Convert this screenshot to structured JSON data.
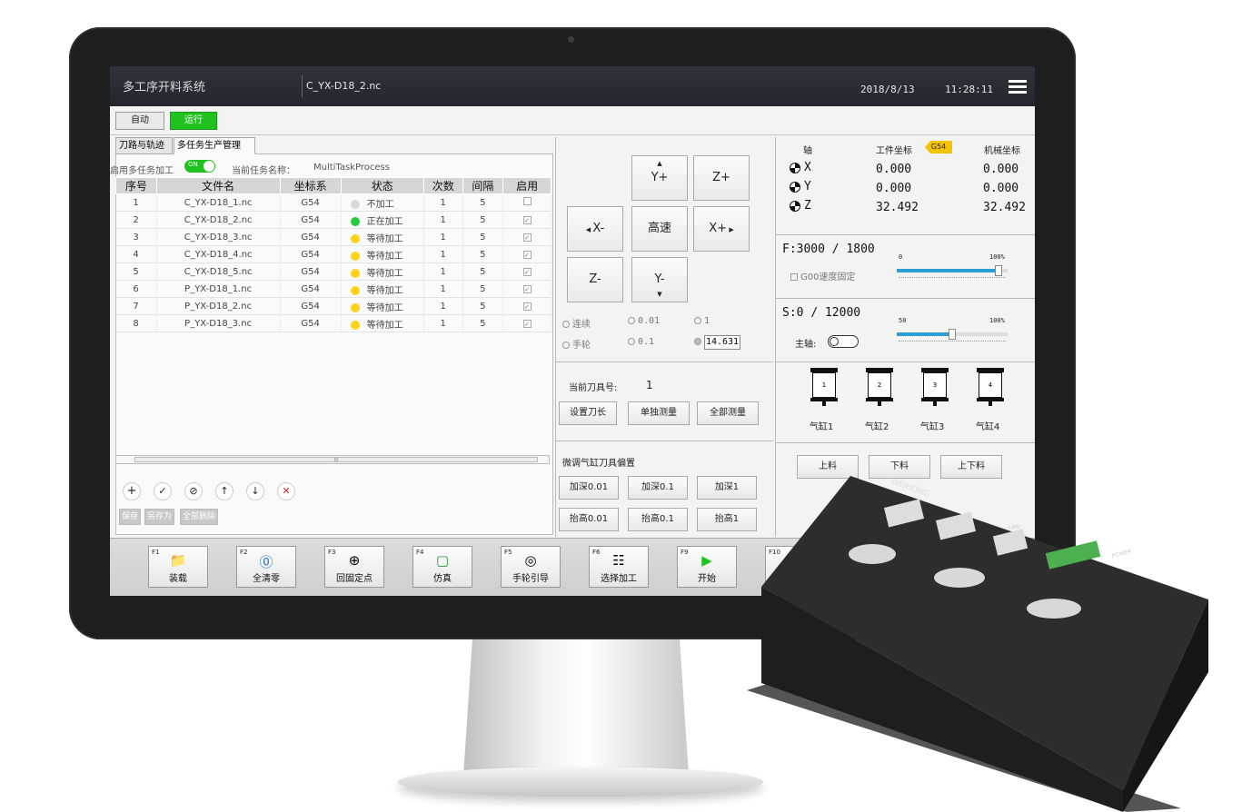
{
  "header": {
    "app_title": "多工序开料系统",
    "file_name": "C_YX-D18_2.nc",
    "date": "2018/8/13",
    "time": "11:28:11"
  },
  "mode": {
    "auto_label": "自动",
    "run_label": "运行"
  },
  "tabs": [
    {
      "label": "刀路与轨迹"
    },
    {
      "label": "多任务生产管理"
    }
  ],
  "multitask": {
    "enable_label": "启用多任务加工",
    "toggle_label": "ON",
    "task_name_label": "当前任务名称：",
    "task_name": "MultiTaskProcess"
  },
  "table": {
    "headers": [
      "序号",
      "文件名",
      "坐标系",
      "状态",
      "次数",
      "间隔",
      "启用"
    ],
    "rows": [
      {
        "no": "1",
        "file": "C_YX-D18_1.nc",
        "coord": "G54",
        "status": "不加工",
        "count": "1",
        "interval": "5",
        "status_color": "#d9d9d9",
        "enabled": false
      },
      {
        "no": "2",
        "file": "C_YX-D18_2.nc",
        "coord": "G54",
        "status": "正在加工",
        "count": "1",
        "interval": "5",
        "status_color": "#27c93f",
        "enabled": true
      },
      {
        "no": "3",
        "file": "C_YX-D18_3.nc",
        "coord": "G54",
        "status": "等待加工",
        "count": "1",
        "interval": "5",
        "status_color": "#ffd21a",
        "enabled": true
      },
      {
        "no": "4",
        "file": "C_YX-D18_4.nc",
        "coord": "G54",
        "status": "等待加工",
        "count": "1",
        "interval": "5",
        "status_color": "#ffd21a",
        "enabled": true
      },
      {
        "no": "5",
        "file": "C_YX-D18_5.nc",
        "coord": "G54",
        "status": "等待加工",
        "count": "1",
        "interval": "5",
        "status_color": "#ffd21a",
        "enabled": true
      },
      {
        "no": "6",
        "file": "P_YX-D18_1.nc",
        "coord": "G54",
        "status": "等待加工",
        "count": "1",
        "interval": "5",
        "status_color": "#ffd21a",
        "enabled": true
      },
      {
        "no": "7",
        "file": "P_YX-D18_2.nc",
        "coord": "G54",
        "status": "等待加工",
        "count": "1",
        "interval": "5",
        "status_color": "#ffd21a",
        "enabled": true
      },
      {
        "no": "8",
        "file": "P_YX-D18_3.nc",
        "coord": "G54",
        "status": "等待加工",
        "count": "1",
        "interval": "5",
        "status_color": "#ffd21a",
        "enabled": true
      }
    ]
  },
  "scroll_label": "III",
  "file_buttons": {
    "save": "保存",
    "save_as": "另存为",
    "delete_all": "全部删除"
  },
  "jog": {
    "y_plus": "Y+",
    "z_plus": "Z+",
    "x_minus": "X-",
    "fast": "高速",
    "x_plus": "X+",
    "z_minus": "Z-",
    "y_minus": "Y-"
  },
  "step": {
    "continuous": "连续",
    "handwheel": "手轮",
    "s001": "0.01",
    "s01": "0.1",
    "s1": "1",
    "custom": "14.631"
  },
  "tool": {
    "current_label": "当前刀具号:",
    "current_value": "1",
    "set_length": "设置刀长",
    "single_measure": "单独测量",
    "all_measure": "全部测量"
  },
  "adjust": {
    "title": "微调气缸刀具偏置",
    "deeper_001": "加深0.01",
    "deeper_01": "加深0.1",
    "deeper_1": "加深1",
    "raise_001": "抬高0.01",
    "raise_01": "抬高0.1",
    "raise_1": "抬高1"
  },
  "coords": {
    "axis_label": "轴",
    "work_label": "工件坐标",
    "work_system": "G54",
    "machine_label": "机械坐标",
    "axes": [
      {
        "name": "X",
        "work": "0.000",
        "machine": "0.000"
      },
      {
        "name": "Y",
        "work": "0.000",
        "machine": "0.000"
      },
      {
        "name": "Z",
        "work": "32.492",
        "machine": "32.492"
      }
    ]
  },
  "feed": {
    "label": "F:",
    "value": "3000",
    "sep": "/",
    "max": "1800",
    "g00_label": "G00速度固定",
    "min_label": "0",
    "max_label": "100%",
    "override_fraction": 0.92
  },
  "spindle": {
    "label": "S:",
    "value": "0",
    "sep": "/",
    "max": "12000",
    "spindle_label": "主轴:",
    "min_label": "50",
    "max_label": "100%",
    "override_fraction": 0.5
  },
  "cylinders": [
    {
      "num": "1",
      "label": "气缸1"
    },
    {
      "num": "2",
      "label": "气缸2"
    },
    {
      "num": "3",
      "label": "气缸3"
    },
    {
      "num": "4",
      "label": "气缸4"
    }
  ],
  "loading": {
    "load": "上料",
    "unload": "下料",
    "load_unload": "上下料"
  },
  "fkeys": [
    {
      "key": "F1",
      "label": "装载"
    },
    {
      "key": "F2",
      "label": "全清零"
    },
    {
      "key": "F3",
      "label": "回固定点"
    },
    {
      "key": "F4",
      "label": "仿真"
    },
    {
      "key": "F5",
      "label": "手轮引导"
    },
    {
      "key": "F6",
      "label": "选择加工"
    },
    {
      "key": "F9",
      "label": "开始"
    },
    {
      "key": "F10",
      "label": ""
    }
  ],
  "device": {
    "brand": "WEIHONG",
    "lan": "LAN",
    "power": "POWER"
  }
}
